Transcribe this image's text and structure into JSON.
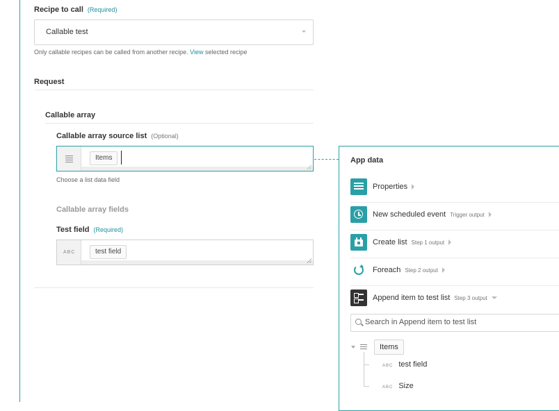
{
  "form": {
    "recipe_label": "Recipe to call",
    "recipe_required": "(Required)",
    "recipe_value": "Callable test",
    "recipe_hint_prefix": "Only callable recipes can be called from another recipe.",
    "recipe_hint_link": "View",
    "recipe_hint_suffix": "selected recipe",
    "request_label": "Request",
    "callable_array_label": "Callable array",
    "source_list_label": "Callable array source list",
    "source_list_optional": "(Optional)",
    "source_list_pill": "Items",
    "source_list_hint": "Choose a list data field",
    "fields_label": "Callable array fields",
    "test_field_label": "Test field",
    "test_field_required": "(Required)",
    "test_field_type": "ABC",
    "test_field_pill": "test field"
  },
  "panel": {
    "title": "App data",
    "rows": [
      {
        "name": "Properties",
        "sub": "",
        "icon": "list-icon",
        "color": "#2aa0a6"
      },
      {
        "name": "New scheduled event",
        "sub": "Trigger output",
        "icon": "clock-icon",
        "color": "#2aa0a6"
      },
      {
        "name": "Create list",
        "sub": "Step 1 output",
        "icon": "calendar-icon",
        "color": "#2aa0a6"
      },
      {
        "name": "Foreach",
        "sub": "Step 2 output",
        "icon": "refresh-icon",
        "color": "#2aa0a6"
      },
      {
        "name": "Append item to test list",
        "sub": "Step 3 output",
        "icon": "checklist-icon",
        "color": "#333333"
      }
    ],
    "search_placeholder": "Search in Append item to test list",
    "tree": {
      "root": "Items",
      "children": [
        {
          "type": "ABC",
          "name": "test field"
        },
        {
          "type": "ABC",
          "name": "Size"
        }
      ]
    }
  }
}
